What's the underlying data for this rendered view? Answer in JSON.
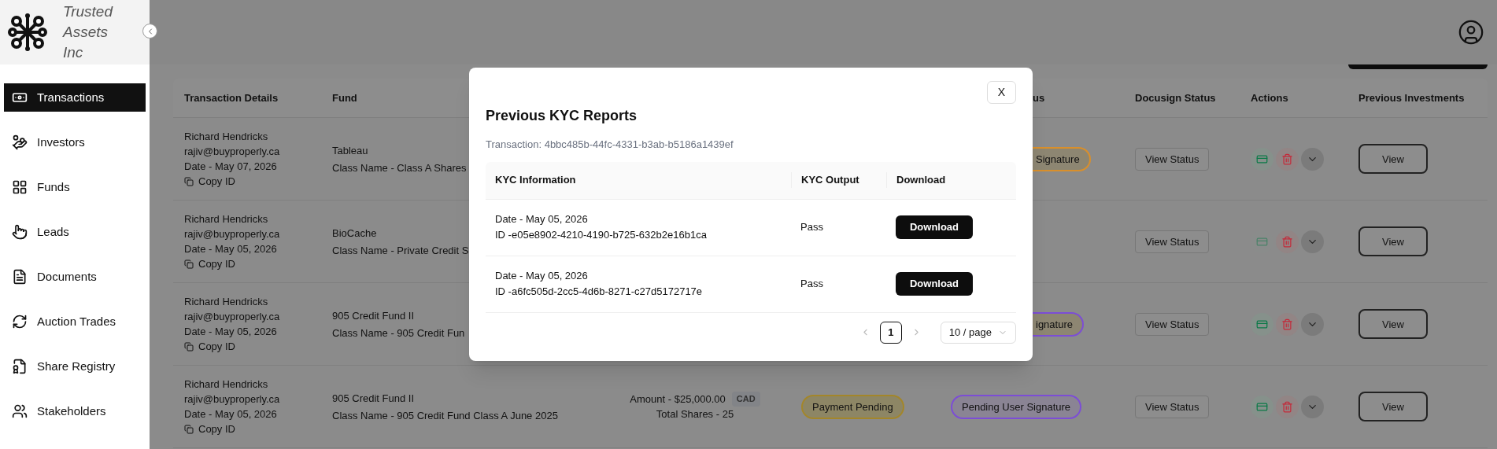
{
  "sidebar": {
    "logo_text": "Trusted Assets Inc",
    "items": [
      {
        "label": "Transactions",
        "selected": true
      },
      {
        "label": "Investors",
        "selected": false
      },
      {
        "label": "Funds",
        "selected": false
      },
      {
        "label": "Leads",
        "selected": false
      },
      {
        "label": "Documents",
        "selected": false
      },
      {
        "label": "Auction Trades",
        "selected": false
      },
      {
        "label": "Share Registry",
        "selected": false
      },
      {
        "label": "Stakeholders",
        "selected": false
      }
    ]
  },
  "table": {
    "columns": [
      {
        "label": "Transaction Details"
      },
      {
        "label": "Fund"
      },
      {
        "label": "us"
      },
      {
        "label": "Docusign Status"
      },
      {
        "label": "Actions"
      },
      {
        "label": "Previous Investments"
      }
    ],
    "rows": [
      {
        "name": "Richard Hendricks",
        "email": "rajiv@buyproperly.ca",
        "date": "Date - May 07, 2026",
        "copy_label": "Copy ID",
        "fund": "Tableau",
        "class_name": "Class Name - Class A Shares",
        "status": {
          "label": "Signature",
          "color": "#d98f2b",
          "cut_left": true
        },
        "docusign": "View Status",
        "approve_enabled": true,
        "view": "View"
      },
      {
        "name": "Richard Hendricks",
        "email": "rajiv@buyproperly.ca",
        "date": "Date - May 05, 2026",
        "copy_label": "Copy ID",
        "fund": "BioCache",
        "class_name": "Class Name - Private Credit S",
        "docusign": "View Status",
        "approve_enabled": false,
        "view": "View"
      },
      {
        "name": "Richard Hendricks",
        "email": "rajiv@buyproperly.ca",
        "date": "Date - May 05, 2026",
        "copy_label": "Copy ID",
        "fund": "905 Credit Fund II",
        "class_name": "Class Name - 905 Credit Fun",
        "status": {
          "label": "ignature",
          "color": "#7c4dd6",
          "cut_left": true
        },
        "docusign": "View Status",
        "approve_enabled": true,
        "view": "View"
      },
      {
        "name": "Richard Hendricks",
        "email": "rajiv@buyproperly.ca",
        "date": "Date - May 05, 2026",
        "copy_label": "Copy ID",
        "fund": "905 Credit Fund II",
        "class_name": "Class Name - 905 Credit Fund Class A June 2025",
        "amount": "Amount - $25,000.00",
        "currency": "CAD",
        "shares": "Total Shares - 25",
        "payment_status": {
          "label": "Payment Pending",
          "color": "#a3862a"
        },
        "status": {
          "label": "Pending User Signature",
          "color": "#7c4dd6",
          "cut_left": false
        },
        "docusign": "View Status",
        "approve_enabled": true,
        "view": "View"
      }
    ]
  },
  "modal": {
    "close_label": "X",
    "title": "Previous KYC Reports",
    "transaction": "Transaction: 4bbc485b-44fc-4331-b3ab-b5186a1439ef",
    "columns": [
      "KYC Information",
      "KYC Output",
      "Download"
    ],
    "rows": [
      {
        "date": "Date - May 05, 2026",
        "id": "ID -e05e8902-4210-4190-b725-632b2e16b1ca",
        "output": "Pass",
        "button": "Download"
      },
      {
        "date": "Date - May 05, 2026",
        "id": "ID -a6fc505d-2cc5-4d6b-8271-c27d5172717e",
        "output": "Pass",
        "button": "Download"
      }
    ],
    "pages": [
      {
        "label": "1",
        "selected": true
      }
    ],
    "page_size": "10 / page"
  }
}
